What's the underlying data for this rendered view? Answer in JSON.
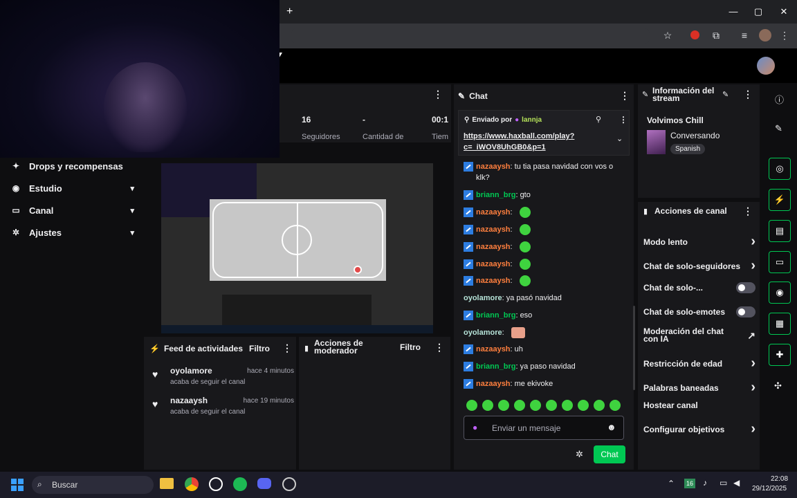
{
  "browser": {
    "new_tab_icon": "+",
    "minimize_icon": "—",
    "maximize_icon": "▢",
    "close_icon": "✕"
  },
  "nav": {
    "items": [
      {
        "label": "Drops y recompensas",
        "icon": "gift-icon"
      },
      {
        "label": "Estudio",
        "icon": "broadcast-icon"
      },
      {
        "label": "Canal",
        "icon": "channel-icon"
      },
      {
        "label": "Ajustes",
        "icon": "gear-icon"
      }
    ]
  },
  "stats": {
    "followers_value": "16",
    "followers_label": "Seguidores",
    "quantity_value": "-",
    "quantity_label": "Cantidad de",
    "time_value": "00:1",
    "time_label": "Tiem"
  },
  "feed": {
    "title": "Feed de actividades",
    "filter": "Filtro",
    "events": [
      {
        "user": "oyolamore",
        "time": "hace 4 minutos",
        "action": "acaba de seguir el canal"
      },
      {
        "user": "nazaaysh",
        "time": "hace 19 minutos",
        "action": "acaba de seguir el canal"
      }
    ]
  },
  "mod_actions": {
    "title_line1": "Acciones de",
    "title_line2": "moderador",
    "filter": "Filtro"
  },
  "chat": {
    "title": "Chat",
    "pinned_by_label": "Enviado por",
    "pinned_by_user": "lannja",
    "pinned_link_line1": "https://www.haxball.com/play?",
    "pinned_link_line2": "c=_iWOV8UhGB0&p=1",
    "input_placeholder": "Enviar un mensaje",
    "send_button": "Chat",
    "messages": [
      {
        "user": "nazaaysh",
        "text": ": tu tia pasa navidad con vos o",
        "text2": "klk?",
        "color": "#ff7f3e"
      },
      {
        "user": "briann_brg",
        "text": ": gto",
        "color": "#00c853"
      },
      {
        "user": "nazaaysh",
        "text": ":",
        "color": "#ff7f3e"
      },
      {
        "user": "nazaaysh",
        "text": ":",
        "color": "#ff7f3e"
      },
      {
        "user": "nazaaysh",
        "text": ":",
        "color": "#ff7f3e"
      },
      {
        "user": "nazaaysh",
        "text": ":",
        "color": "#ff7f3e"
      },
      {
        "user": "nazaaysh",
        "text": ":",
        "color": "#ff7f3e"
      },
      {
        "user": "oyolamore",
        "text": ": ya pasó navidad",
        "color": "#b6e3d8"
      },
      {
        "user": "briann_brg",
        "text": ": eso",
        "color": "#00c853"
      },
      {
        "user": "oyolamore",
        "text": ":",
        "color": "#b6e3d8"
      },
      {
        "user": "nazaaysh",
        "text": ": uh",
        "color": "#ff7f3e"
      },
      {
        "user": "briann_brg",
        "text": ": ya paso navidad",
        "color": "#00c853"
      },
      {
        "user": "nazaaysh",
        "text": ": me ekivoke",
        "color": "#ff7f3e"
      }
    ]
  },
  "info": {
    "title_line1": "Información del",
    "title_line2": "stream",
    "stream_title": "Volvimos Chill",
    "category": "Conversando",
    "language": "Spanish"
  },
  "acciones": {
    "title": "Acciones de canal",
    "items": [
      {
        "label": "Modo lento",
        "kind": "arrow"
      },
      {
        "label": "Chat de solo-seguidores",
        "kind": "arrow"
      },
      {
        "label": "Chat de solo-...",
        "kind": "toggle"
      },
      {
        "label": "Chat de solo-emotes",
        "kind": "toggle"
      },
      {
        "label": "Moderación del chat con IA",
        "kind": "external"
      },
      {
        "label": "Restricción de edad",
        "kind": "arrow"
      },
      {
        "label": "Palabras baneadas",
        "kind": "arrow"
      },
      {
        "label": "Hostear canal",
        "kind": "none"
      },
      {
        "label": "Configurar objetivos",
        "kind": "arrow"
      }
    ]
  },
  "taskbar": {
    "search_placeholder": "Buscar",
    "tray_badge": "16",
    "time": "22:08",
    "date": "29/12/2025"
  },
  "colors": {
    "accent": "#00c853",
    "panel": "#18181b",
    "badge_blue": "#2d7de1"
  }
}
